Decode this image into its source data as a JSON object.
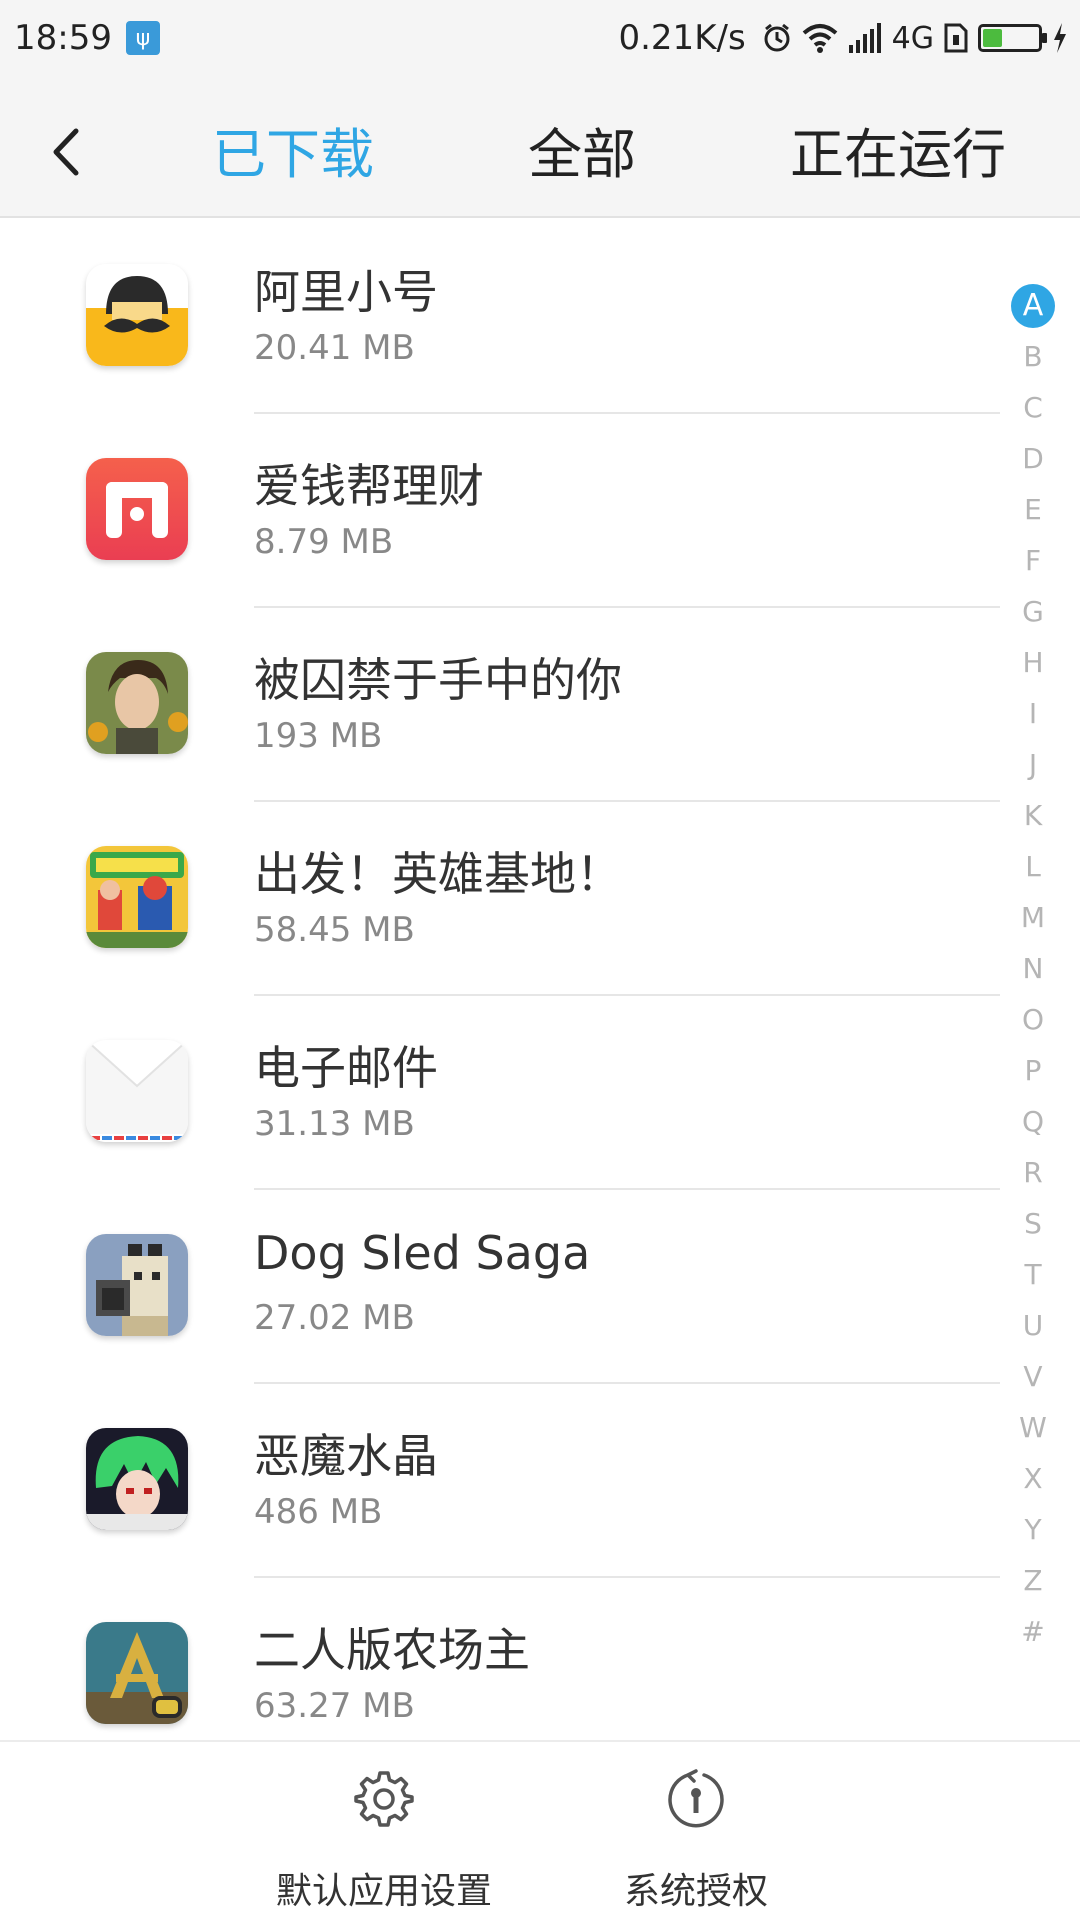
{
  "status_bar": {
    "time": "18:59",
    "net_speed": "0.21K/s",
    "network_type": "4G",
    "battery_fraction": 0.35,
    "battery_color": "#4cbb3e"
  },
  "tabs": [
    {
      "label": "已下载",
      "active": true
    },
    {
      "label": "全部",
      "active": false
    },
    {
      "label": "正在运行",
      "active": false
    }
  ],
  "accent_color": "#2fa6e4",
  "apps": [
    {
      "name": "阿里小号",
      "size": "20.41 MB",
      "icon": "mustache-face-icon"
    },
    {
      "name": "爱钱帮理财",
      "size": "8.79 MB",
      "icon": "h-logo-icon"
    },
    {
      "name": "被囚禁于手中的你",
      "size": "193 MB",
      "icon": "portrait-icon"
    },
    {
      "name": "出发！英雄基地！",
      "size": "58.45 MB",
      "icon": "hero-base-icon"
    },
    {
      "name": "电子邮件",
      "size": "31.13 MB",
      "icon": "envelope-icon"
    },
    {
      "name": "Dog Sled Saga",
      "size": "27.02 MB",
      "icon": "pixel-dog-icon"
    },
    {
      "name": "恶魔水晶",
      "size": "486 MB",
      "icon": "green-hair-character-icon"
    },
    {
      "name": "二人版农场主",
      "size": "63.27 MB",
      "icon": "farm-2p-icon"
    }
  ],
  "alphabet": [
    "A",
    "B",
    "C",
    "D",
    "E",
    "F",
    "G",
    "H",
    "I",
    "J",
    "K",
    "L",
    "M",
    "N",
    "O",
    "P",
    "Q",
    "R",
    "S",
    "T",
    "U",
    "V",
    "W",
    "X",
    "Y",
    "Z",
    "#"
  ],
  "alphabet_active": "A",
  "bottom_bar": {
    "default_apps_label": "默认应用设置",
    "permissions_label": "系统授权"
  }
}
